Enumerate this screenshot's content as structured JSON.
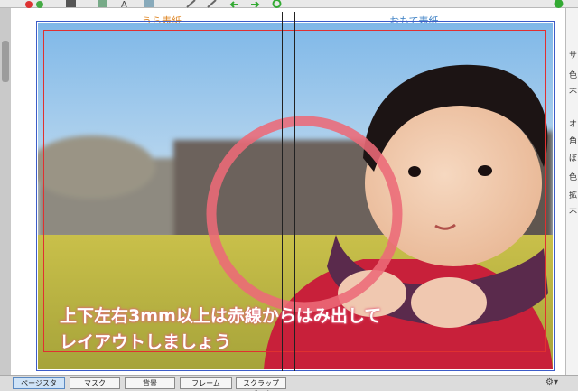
{
  "canvas": {
    "back_cover_label": "うら表紙",
    "front_cover_label": "おもて表紙",
    "notice_line1": "上下左右3mm以上は赤線からはみ出して",
    "notice_line2": "レイアウトしましょう",
    "barcode_text": "||||||||||"
  },
  "right_panel": {
    "chars": [
      "サ",
      "色",
      "不",
      "オ",
      "角",
      "ぼ",
      "色",
      "拡",
      "不"
    ]
  },
  "bottom_tabs": {
    "items": [
      {
        "label": "ページスタイル"
      },
      {
        "label": "マスク"
      },
      {
        "label": "背景"
      },
      {
        "label": "フレーム"
      },
      {
        "label": "スクラップブック"
      }
    ],
    "active_index": 0,
    "gear": "⚙▾"
  },
  "colors": {
    "back_label": "#e08a2a",
    "front_label": "#3a7fc4",
    "bleed_line": "#e03030",
    "page_frame": "#3c5cc8",
    "circle": "#ec6a78",
    "notice_glow": "#e0607a"
  }
}
